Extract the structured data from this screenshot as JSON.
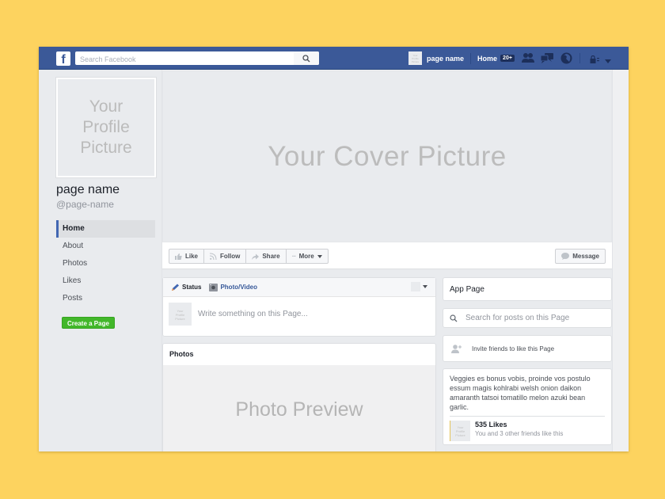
{
  "topbar": {
    "logo": "f",
    "search_placeholder": "Search Facebook",
    "page_thumb_text": "Your\nProfile\nPicture",
    "page_name": "page name",
    "home_label": "Home",
    "home_badge": "20+",
    "icons": [
      "friend-requests-icon",
      "messages-icon",
      "notifications-globe-icon",
      "privacy-lock-icon",
      "account-menu-chevron-icon"
    ]
  },
  "profile": {
    "picture_placeholder": "Your\nProfile\nPicture",
    "name": "page name",
    "handle": "@page-name"
  },
  "sidebar": {
    "items": [
      {
        "label": "Home",
        "active": true
      },
      {
        "label": "About",
        "active": false
      },
      {
        "label": "Photos",
        "active": false
      },
      {
        "label": "Likes",
        "active": false
      },
      {
        "label": "Posts",
        "active": false
      }
    ],
    "create_page_label": "Create a Page"
  },
  "cover": {
    "placeholder": "Your Cover Picture"
  },
  "actions": {
    "like": "Like",
    "follow": "Follow",
    "share": "Share",
    "more": "More",
    "message": "Message"
  },
  "composer": {
    "tab_status": "Status",
    "tab_photo": "Photo/Video",
    "avatar_text": "Your\nProfile\nPicture",
    "placeholder": "Write something on this Page..."
  },
  "photos": {
    "title": "Photos",
    "placeholder": "Photo Preview"
  },
  "right": {
    "app_page": "App Page",
    "search_placeholder": "Search for posts on this Page",
    "invite_label": "Invite friends to like this Page",
    "about_text": "Veggies es bonus vobis, proinde vos postulo essum magis kohlrabi welsh onion daikon amaranth tatsoi tomatillo melon azuki bean garlic.",
    "likes_thumb_text": "Your\nProfile\nPicture",
    "likes_count": "535 Likes",
    "likes_friends": "You and 3 other friends like this"
  },
  "colors": {
    "brand_blue": "#3b5998",
    "background_yellow": "#fdd35f",
    "create_green": "#42b72a",
    "page_bg": "#e9ebee"
  }
}
